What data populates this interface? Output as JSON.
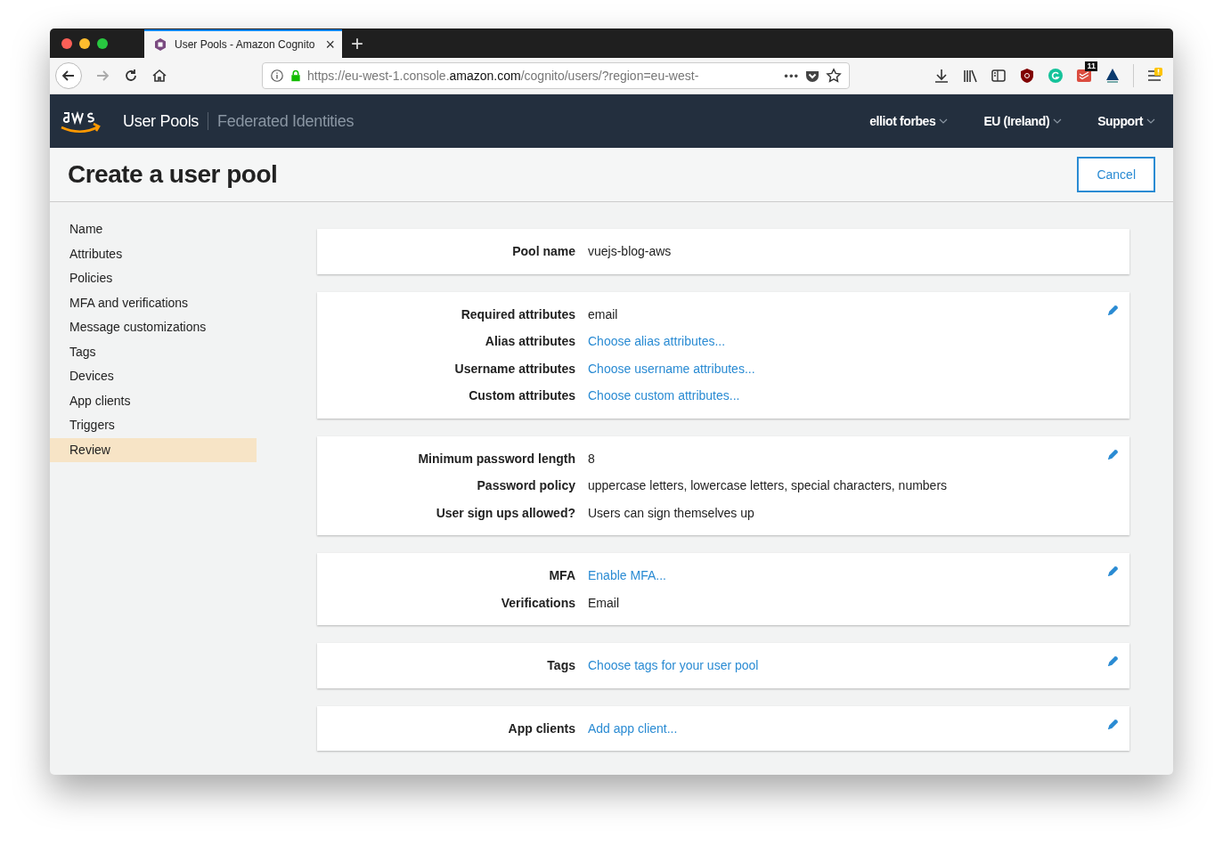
{
  "browser": {
    "tab": {
      "title": "User Pools - Amazon Cognito",
      "close": "×"
    },
    "new_tab": "+",
    "url": {
      "prefix": "https://eu-west-1.console.",
      "domain": "amazon.com",
      "rest": "/cognito/users/?region=eu-west-"
    },
    "url_menu": "•••",
    "extension_badge": "11"
  },
  "header": {
    "nav": [
      {
        "label": "User Pools",
        "selected": true
      },
      {
        "label": "Federated Identities",
        "selected": false
      }
    ],
    "menus": [
      {
        "label": "elliot forbes"
      },
      {
        "label": "EU (Ireland)"
      },
      {
        "label": "Support"
      }
    ]
  },
  "page": {
    "title": "Create a user pool",
    "cancel": "Cancel"
  },
  "sidebar": {
    "items": [
      {
        "label": "Name",
        "selected": false
      },
      {
        "label": "Attributes",
        "selected": false
      },
      {
        "label": "Policies",
        "selected": false
      },
      {
        "label": "MFA and verifications",
        "selected": false
      },
      {
        "label": "Message customizations",
        "selected": false
      },
      {
        "label": "Tags",
        "selected": false
      },
      {
        "label": "Devices",
        "selected": false
      },
      {
        "label": "App clients",
        "selected": false
      },
      {
        "label": "Triggers",
        "selected": false
      },
      {
        "label": "Review",
        "selected": true
      }
    ]
  },
  "sections": [
    {
      "editable": false,
      "rows": [
        {
          "label": "Pool name",
          "value": "vuejs-blog-aws",
          "kind": "text"
        }
      ]
    },
    {
      "editable": true,
      "rows": [
        {
          "label": "Required attributes",
          "value": "email",
          "kind": "text"
        },
        {
          "label": "Alias attributes",
          "value": "Choose alias attributes...",
          "kind": "link"
        },
        {
          "label": "Username attributes",
          "value": "Choose username attributes...",
          "kind": "link"
        },
        {
          "label": "Custom attributes",
          "value": "Choose custom attributes...",
          "kind": "link"
        }
      ]
    },
    {
      "editable": true,
      "rows": [
        {
          "label": "Minimum password length",
          "value": "8",
          "kind": "text"
        },
        {
          "label": "Password policy",
          "value": "uppercase letters, lowercase letters, special characters, numbers",
          "kind": "text"
        },
        {
          "label": "User sign ups allowed?",
          "value": "Users can sign themselves up",
          "kind": "text"
        }
      ]
    },
    {
      "editable": true,
      "rows": [
        {
          "label": "MFA",
          "value": "Enable MFA...",
          "kind": "link"
        },
        {
          "label": "Verifications",
          "value": "Email",
          "kind": "text"
        }
      ]
    },
    {
      "editable": true,
      "rows": [
        {
          "label": "Tags",
          "value": "Choose tags for your user pool",
          "kind": "link"
        }
      ]
    },
    {
      "editable": true,
      "rows": [
        {
          "label": "App clients",
          "value": "Add app client...",
          "kind": "link"
        }
      ]
    }
  ]
}
